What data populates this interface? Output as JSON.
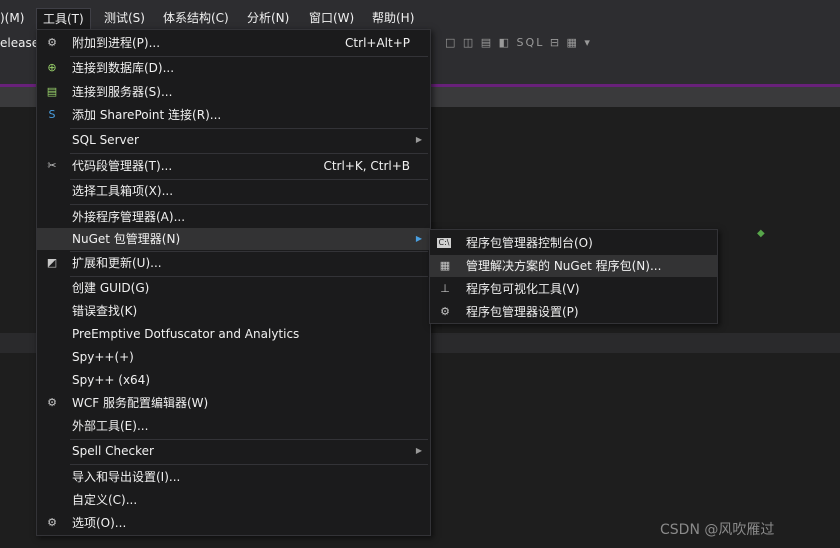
{
  "menubar": {
    "items": [
      ")(M)",
      "工具(T)",
      "测试(S)",
      "体系结构(C)",
      "分析(N)",
      "窗口(W)",
      "帮助(H)"
    ]
  },
  "toolbar": {
    "config_text": "elease",
    "icons_text": "□ ◫ ▤ ◧ SQL ⊟ ▦ ▾"
  },
  "tools_menu": {
    "items": [
      {
        "label": "附加到进程(P)...",
        "shortcut": "Ctrl+Alt+P"
      },
      {
        "label": "连接到数据库(D)..."
      },
      {
        "label": "连接到服务器(S)..."
      },
      {
        "label": "添加 SharePoint 连接(R)..."
      },
      {
        "label": "SQL Server"
      },
      {
        "label": "代码段管理器(T)...",
        "shortcut": "Ctrl+K, Ctrl+B"
      },
      {
        "label": "选择工具箱项(X)..."
      },
      {
        "label": "外接程序管理器(A)..."
      },
      {
        "label": "NuGet 包管理器(N)"
      },
      {
        "label": "扩展和更新(U)..."
      },
      {
        "label": "创建 GUID(G)"
      },
      {
        "label": "错误查找(K)"
      },
      {
        "label": "PreEmptive Dotfuscator and Analytics"
      },
      {
        "label": "Spy++(+)"
      },
      {
        "label": "Spy++ (x64)"
      },
      {
        "label": "WCF 服务配置编辑器(W)"
      },
      {
        "label": "外部工具(E)..."
      },
      {
        "label": "Spell Checker"
      },
      {
        "label": "导入和导出设置(I)..."
      },
      {
        "label": "自定义(C)..."
      },
      {
        "label": "选项(O)..."
      }
    ]
  },
  "nuget_submenu": {
    "items": [
      {
        "label": "程序包管理器控制台(O)",
        "icon_text": "C:\\"
      },
      {
        "label": "管理解决方案的 NuGet 程序包(N)..."
      },
      {
        "label": "程序包可视化工具(V)"
      },
      {
        "label": "程序包管理器设置(P)"
      }
    ]
  },
  "watermark": "CSDN @风吹雁过"
}
